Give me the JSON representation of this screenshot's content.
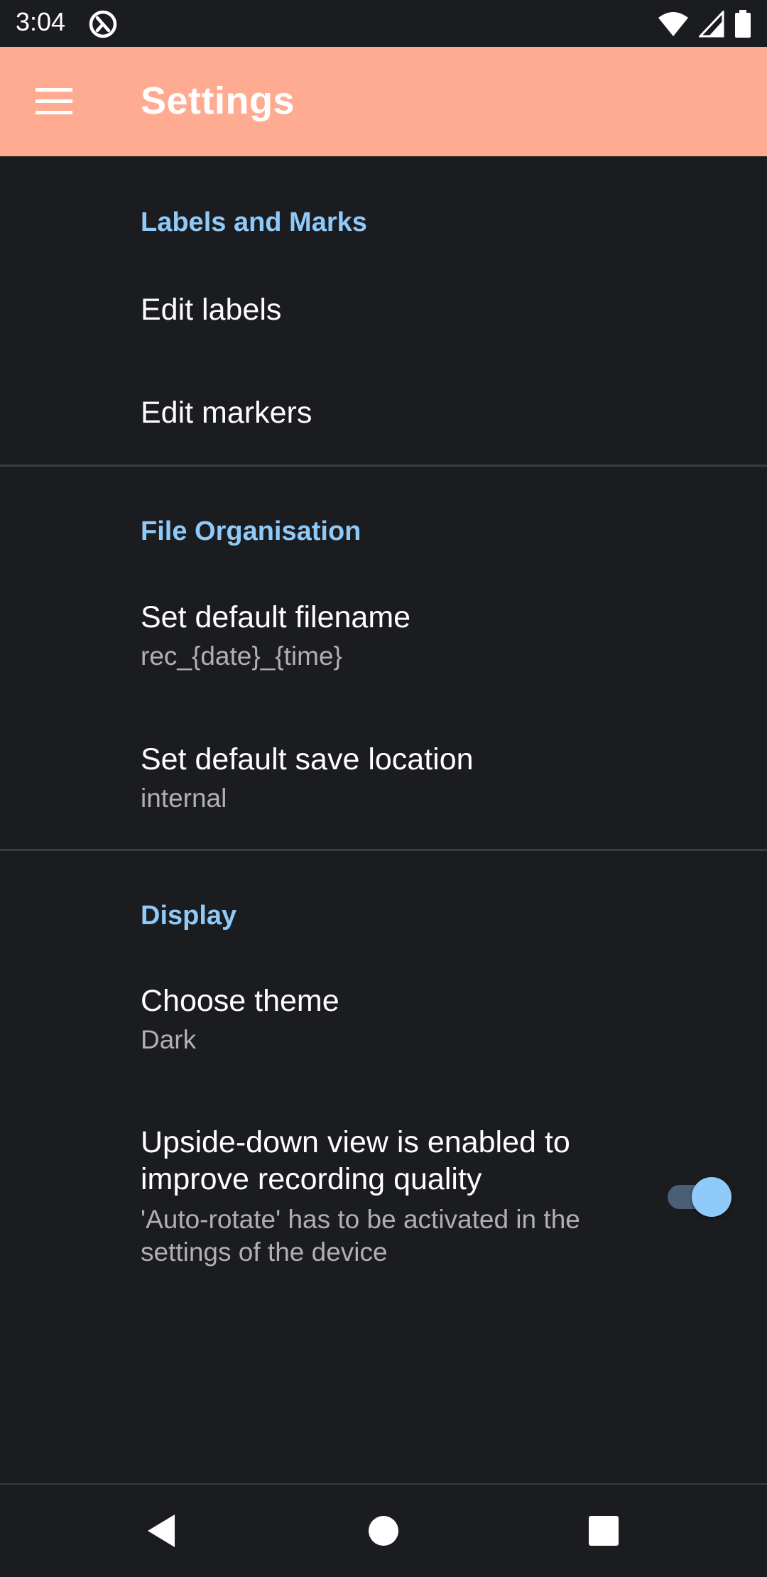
{
  "status_bar": {
    "time": "3:04",
    "icons": [
      "app-notification-icon",
      "wifi-icon",
      "cell-signal-icon",
      "battery-icon"
    ]
  },
  "app_bar": {
    "title": "Settings",
    "background": "#ffab91",
    "menu_icon": "hamburger-menu-icon"
  },
  "sections": {
    "labels_marks": {
      "header": "Labels and Marks",
      "edit_labels": "Edit labels",
      "edit_markers": "Edit markers"
    },
    "file_org": {
      "header": "File Organisation",
      "filename_title": "Set default filename",
      "filename_value": "rec_{date}_{time}",
      "location_title": "Set default save location",
      "location_value": "internal"
    },
    "display": {
      "header": "Display",
      "theme_title": "Choose theme",
      "theme_value": "Dark",
      "upside_title": "Upside-down view is enabled to improve recording quality",
      "upside_summary": "'Auto-rotate' has to be activated in the settings of the device",
      "upside_enabled": true
    }
  },
  "colors": {
    "accent": "#90caf9",
    "background": "#1b1c1f",
    "summary_text": "#b0b0b3"
  },
  "nav_bar": {
    "icons": [
      "back-icon",
      "home-icon",
      "recents-icon"
    ]
  }
}
